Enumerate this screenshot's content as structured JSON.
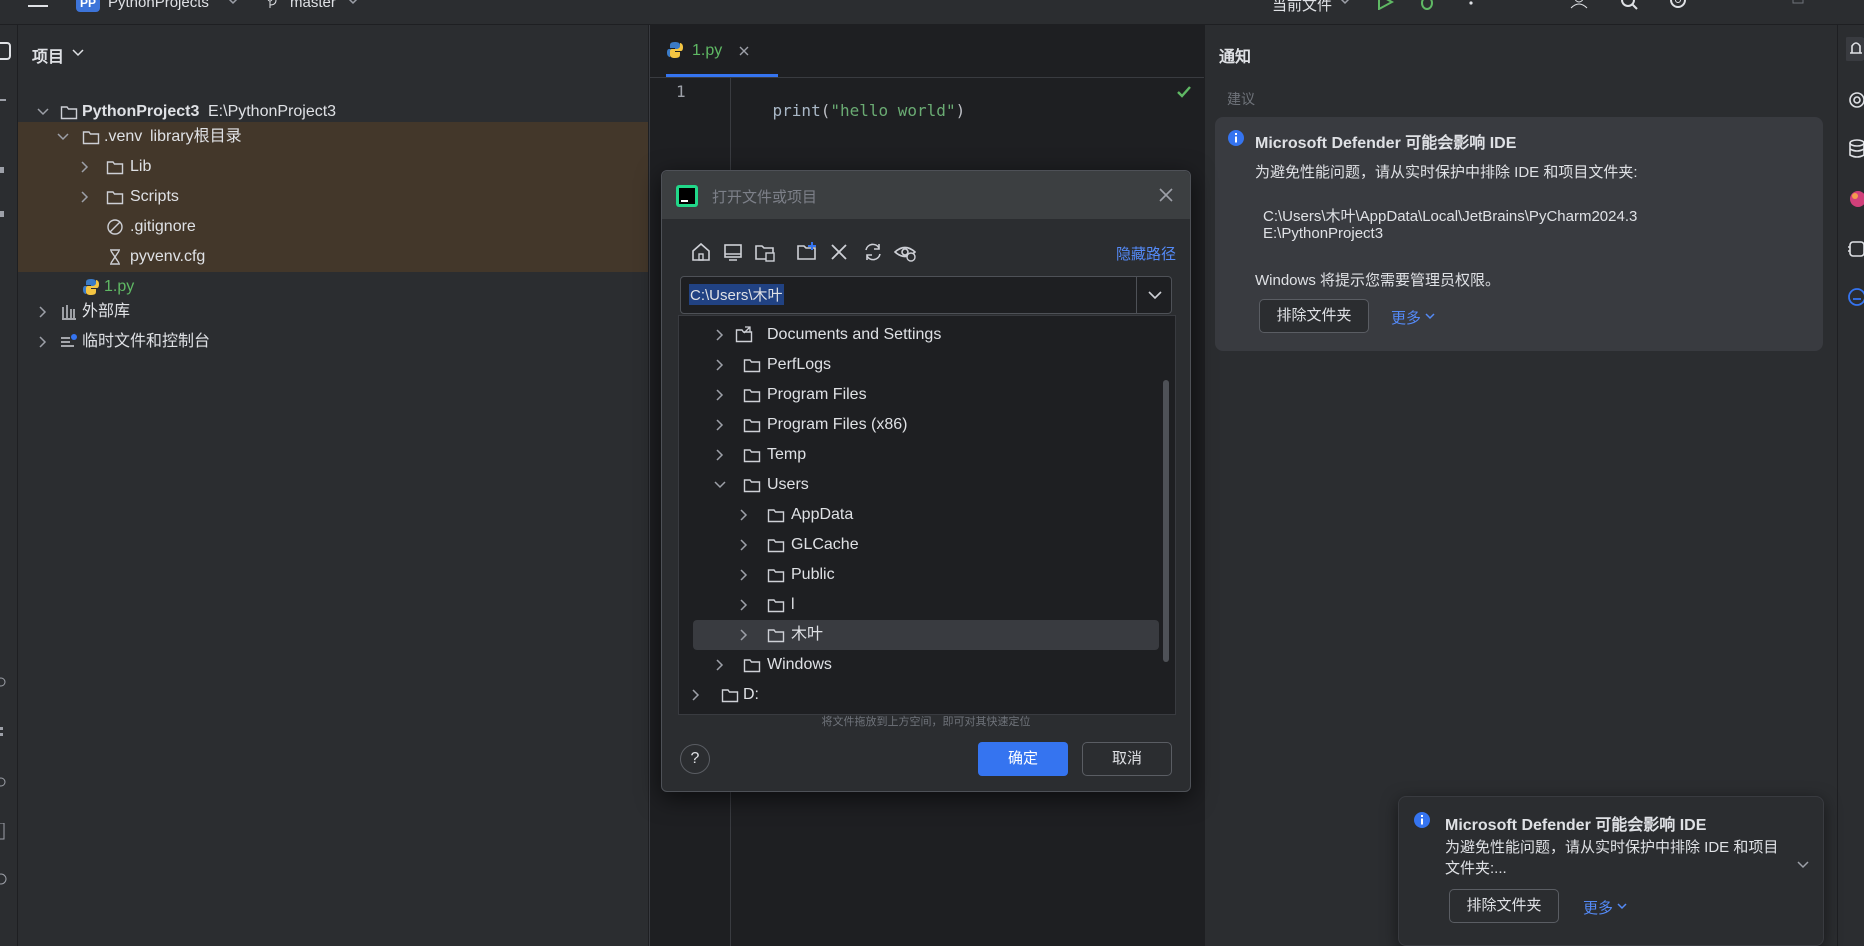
{
  "topbar": {
    "project_badge": "PP",
    "project_name": "PythonProjects",
    "branch": "master",
    "run_config": "当前文件"
  },
  "project_panel": {
    "title": "项目",
    "tree": [
      {
        "label": "PythonProject3",
        "hint": "E:\\PythonProject3"
      },
      {
        "label": ".venv",
        "hint": "library根目录"
      },
      {
        "label": "Lib"
      },
      {
        "label": "Scripts"
      },
      {
        "label": ".gitignore"
      },
      {
        "label": "pyvenv.cfg"
      },
      {
        "label": "1.py"
      },
      {
        "label": "外部库"
      },
      {
        "label": "临时文件和控制台"
      }
    ]
  },
  "editor": {
    "tab_label": "1.py",
    "line_number": "1",
    "code_fn": "print",
    "code_open": "(",
    "code_string": "\"hello world\"",
    "code_close": ")"
  },
  "dialog": {
    "title": "打开文件或项目",
    "hide_path_label": "隐藏路径",
    "path_value": "C:\\Users\\木叶",
    "tree": [
      {
        "label": "Documents and Settings"
      },
      {
        "label": "PerfLogs"
      },
      {
        "label": "Program Files"
      },
      {
        "label": "Program Files (x86)"
      },
      {
        "label": "Temp"
      },
      {
        "label": "Users"
      },
      {
        "label": "AppData"
      },
      {
        "label": "GLCache"
      },
      {
        "label": "Public"
      },
      {
        "label": "l"
      },
      {
        "label": "木叶"
      },
      {
        "label": "Windows"
      },
      {
        "label": "D:"
      }
    ],
    "drop_hint": "将文件拖放到上方空间，即可对其快速定位",
    "help_label": "?",
    "ok_label": "确定",
    "cancel_label": "取消"
  },
  "notifications": {
    "title": "通知",
    "section_label": "建议",
    "card": {
      "title": "Microsoft Defender 可能会影响 IDE",
      "body": "为避免性能问题，请从实时保护中排除 IDE 和项目文件夹:",
      "path1": "C:\\Users\\木叶\\AppData\\Local\\JetBrains\\PyCharm2024.3",
      "path2": "E:\\PythonProject3",
      "note": "Windows 将提示您需要管理员权限。",
      "exclude_label": "排除文件夹",
      "more_label": "更多"
    }
  },
  "toast": {
    "title": "Microsoft Defender 可能会影响 IDE",
    "body_line1": "为避免性能问题，请从实时保护中排除 IDE 和项目",
    "body_line2": "文件夹:...",
    "exclude_label": "排除文件夹",
    "more_label": "更多"
  },
  "colors": {
    "accent": "#3574f0",
    "link": "#548af7",
    "selection_row": "#43372a",
    "python_file": "#5fb864"
  }
}
